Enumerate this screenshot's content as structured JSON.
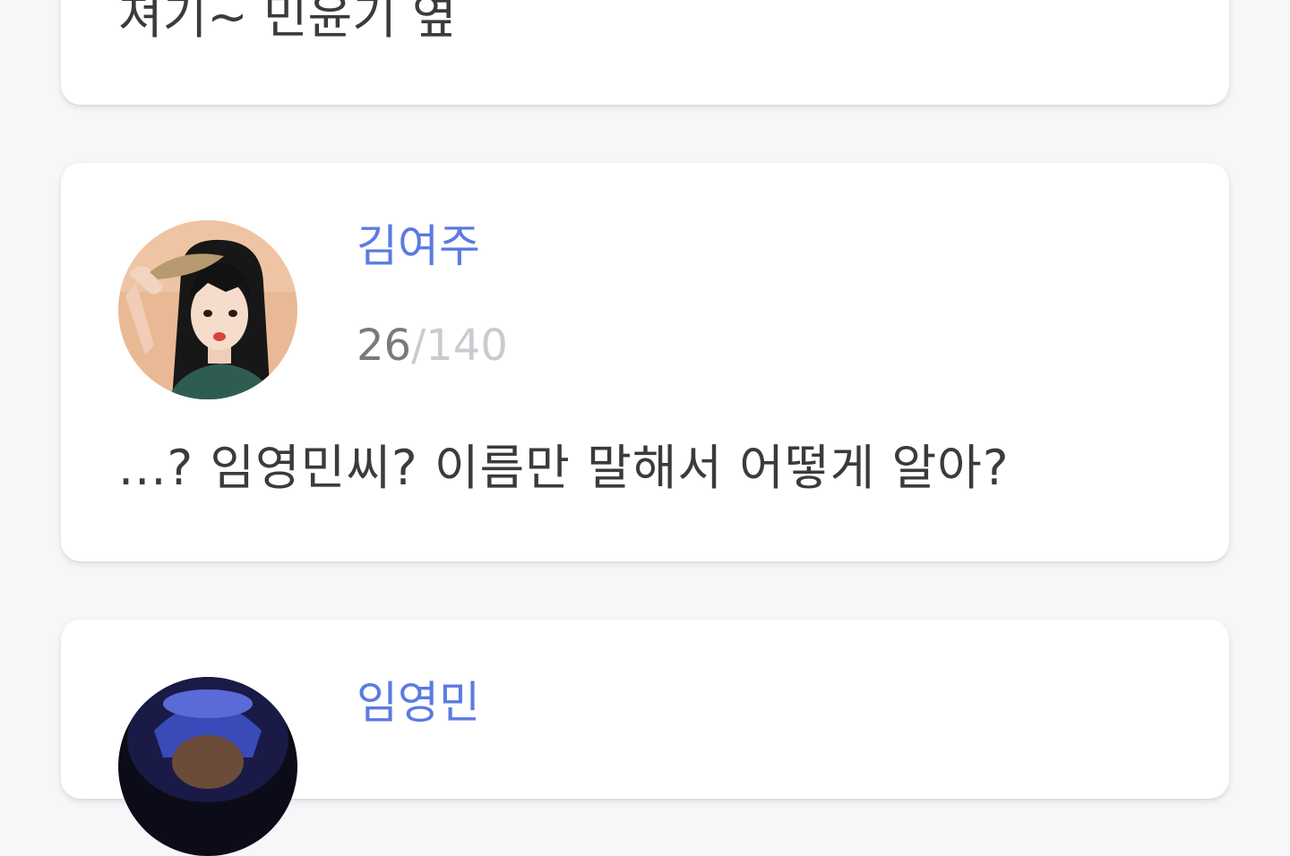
{
  "messages": [
    {
      "text": "져기~ 민윤기 옆"
    },
    {
      "author": "김여주",
      "count": "26",
      "separator": "/",
      "max": "140",
      "text": "...? 임영민씨? 이름만 말해서 어떻게 알아?"
    },
    {
      "author": "임영민"
    }
  ],
  "colors": {
    "background": "#f6f7f9",
    "card": "#ffffff",
    "author": "#5b7be0",
    "text": "#3b3b3b",
    "count": "#7a7a7a",
    "count_max": "#c9cbd0"
  },
  "icons": {
    "avatar_kim": "profile-photo",
    "avatar_lim": "profile-photo"
  }
}
